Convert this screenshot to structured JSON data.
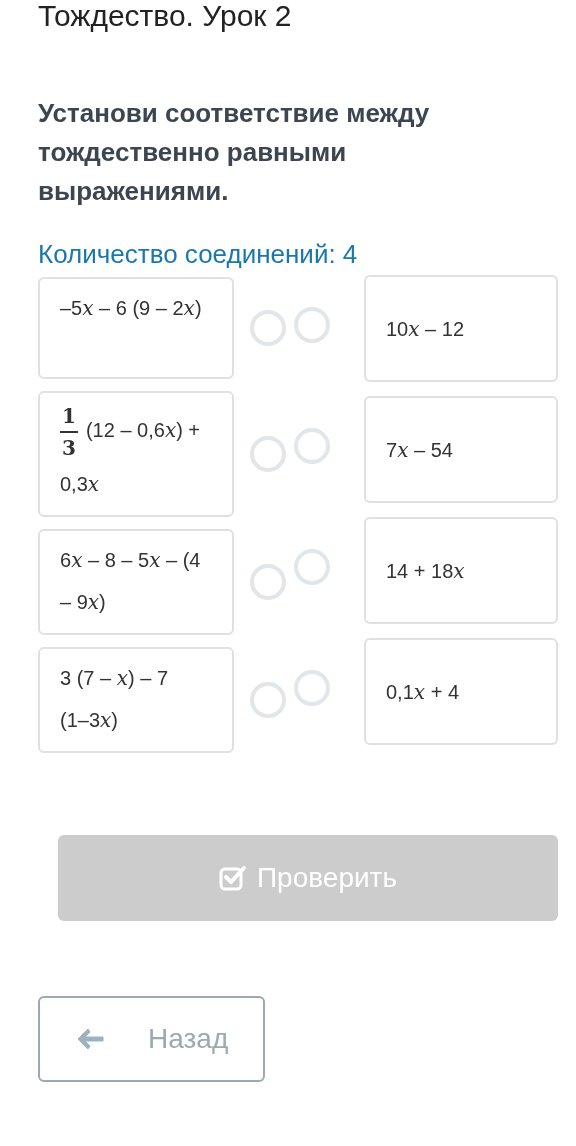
{
  "lesson_title": "Тождество. Урок 2",
  "task": "Установи соответствие между тождественно равными выражениями.",
  "connections_count": "Количество соединений: 4",
  "left_items": [
    {
      "segments": [
        {
          "kind": "text",
          "text": "–5"
        },
        {
          "kind": "var",
          "text": "x"
        },
        {
          "kind": "text",
          "text": " – 6 (9 – 2"
        },
        {
          "kind": "var",
          "text": "x"
        },
        {
          "kind": "text",
          "text": ")"
        }
      ]
    },
    {
      "fraction": {
        "numerator": "1",
        "denominator": "3"
      },
      "segments": [
        {
          "kind": "text",
          "text": "(12 – 0,6"
        },
        {
          "kind": "var",
          "text": "x"
        },
        {
          "kind": "text",
          "text": ") + 0,3"
        },
        {
          "kind": "var",
          "text": "x"
        }
      ]
    },
    {
      "segments": [
        {
          "kind": "text",
          "text": "6"
        },
        {
          "kind": "var",
          "text": "x"
        },
        {
          "kind": "text",
          "text": " – 8 – 5"
        },
        {
          "kind": "var",
          "text": "x"
        },
        {
          "kind": "text",
          "text": " – (4 – 9"
        },
        {
          "kind": "var",
          "text": "x"
        },
        {
          "kind": "text",
          "text": ")"
        }
      ]
    },
    {
      "segments": [
        {
          "kind": "text",
          "text": "3 (7 – "
        },
        {
          "kind": "var",
          "text": "x"
        },
        {
          "kind": "text",
          "text": ") – 7 (1–3"
        },
        {
          "kind": "var",
          "text": "x"
        },
        {
          "kind": "text",
          "text": ")"
        }
      ]
    }
  ],
  "right_items": [
    {
      "segments": [
        {
          "kind": "text",
          "text": "10"
        },
        {
          "kind": "var",
          "text": "x"
        },
        {
          "kind": "text",
          "text": " – 12"
        }
      ]
    },
    {
      "segments": [
        {
          "kind": "text",
          "text": "7"
        },
        {
          "kind": "var",
          "text": "x"
        },
        {
          "kind": "text",
          "text": " – 54"
        }
      ]
    },
    {
      "segments": [
        {
          "kind": "text",
          "text": "14 + 18"
        },
        {
          "kind": "var",
          "text": "x"
        }
      ]
    },
    {
      "segments": [
        {
          "kind": "text",
          "text": "0,1"
        },
        {
          "kind": "var",
          "text": "x"
        },
        {
          "kind": "text",
          "text": " + 4"
        }
      ]
    }
  ],
  "check_button": {
    "label": "Проверить",
    "disabled": true
  },
  "back_button": {
    "label": "Назад"
  }
}
